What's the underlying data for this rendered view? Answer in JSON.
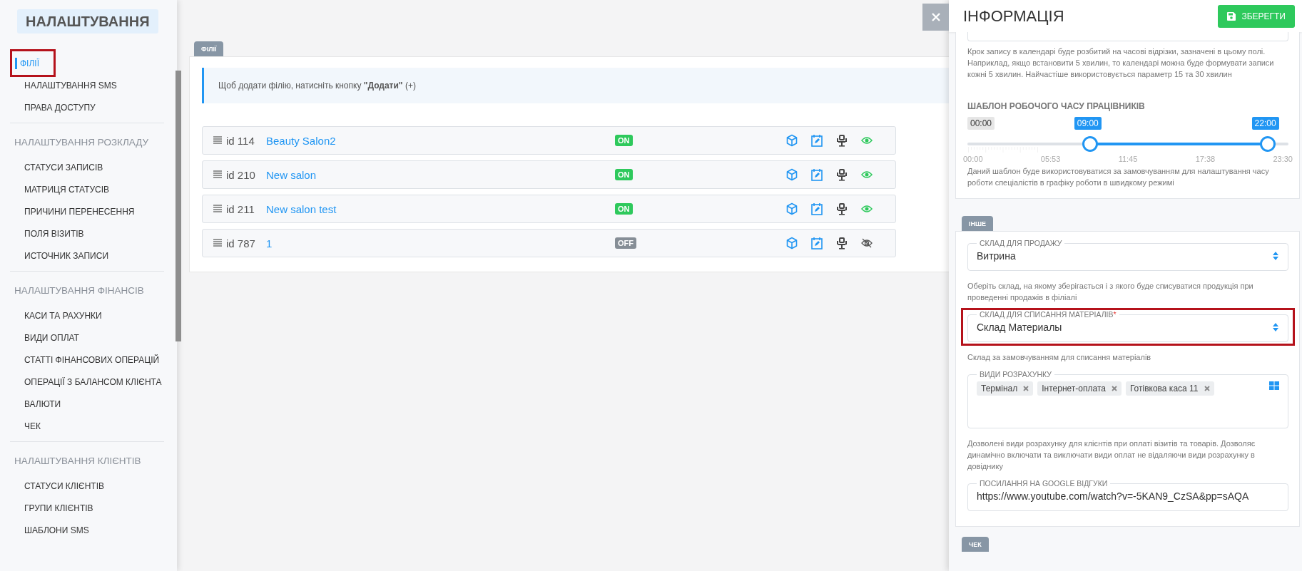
{
  "sidebar": {
    "title": "НАЛАШТУВАННЯ",
    "sections": [
      {
        "items": [
          {
            "label": "ФІЛІЇ",
            "selected": true,
            "highlighted": true
          },
          {
            "label": "НАЛАШТУВАННЯ SMS",
            "selected": false,
            "highlighted": false
          },
          {
            "label": "ПРАВА ДОСТУПУ",
            "selected": false,
            "highlighted": false
          }
        ]
      },
      {
        "heading": "НАЛАШТУВАННЯ РОЗКЛАДУ",
        "items": [
          {
            "label": "СТАТУСИ ЗАПИСІВ",
            "selected": false,
            "highlighted": false
          },
          {
            "label": "МАТРИЦЯ СТАТУСІВ",
            "selected": false,
            "highlighted": false
          },
          {
            "label": "ПРИЧИНИ ПЕРЕНЕСЕННЯ",
            "selected": false,
            "highlighted": false
          },
          {
            "label": "ПОЛЯ ВІЗИТІВ",
            "selected": false,
            "highlighted": false
          },
          {
            "label": "ИСТОЧНИК ЗАПИСИ",
            "selected": false,
            "highlighted": false
          }
        ]
      },
      {
        "heading": "НАЛАШТУВАННЯ ФІНАНСІВ",
        "items": [
          {
            "label": "КАСИ ТА РАХУНКИ",
            "selected": false,
            "highlighted": false
          },
          {
            "label": "ВИДИ ОПЛАТ",
            "selected": false,
            "highlighted": false
          },
          {
            "label": "СТАТТІ ФІНАНСОВИХ ОПЕРАЦІЙ",
            "selected": false,
            "highlighted": false
          },
          {
            "label": "ОПЕРАЦІЇ З БАЛАНСОМ КЛІЄНТА",
            "selected": false,
            "highlighted": false
          },
          {
            "label": "ВАЛЮТИ",
            "selected": false,
            "highlighted": false
          },
          {
            "label": "ЧЕК",
            "selected": false,
            "highlighted": false
          }
        ]
      },
      {
        "heading": "НАЛАШТУВАННЯ КЛІЄНТІВ",
        "items": [
          {
            "label": "СТАТУСИ КЛІЄНТІВ",
            "selected": false,
            "highlighted": false
          },
          {
            "label": "ГРУПИ КЛІЄНТІВ",
            "selected": false,
            "highlighted": false
          },
          {
            "label": "ШАБЛОНИ SMS",
            "selected": false,
            "highlighted": false
          }
        ]
      }
    ]
  },
  "branches": {
    "tab": "ФІЛІЇ",
    "notice": "Щоб додати філію, натисніть кнопку **\"Додати\"** (+)",
    "rows": [
      {
        "id": "id 114",
        "name": "Beauty Salon2",
        "status": "ON",
        "on": true,
        "visible": true
      },
      {
        "id": "id 210",
        "name": "New salon",
        "status": "ON",
        "on": true,
        "visible": true
      },
      {
        "id": "id 211",
        "name": "New salon test",
        "status": "ON",
        "on": true,
        "visible": true
      },
      {
        "id": "id 787",
        "name": "1",
        "status": "OFF",
        "on": false,
        "visible": false
      }
    ]
  },
  "panel": {
    "title": "ІНФОРМАЦІЯ",
    "save_button": "ЗБЕРЕГТИ",
    "step_hint": "Крок запису в календарі буде розбитий на часові відрізки, зазначені в цьому полі. Наприклад, якщо встановити 5 хвилин, то календарі можна буде формувати записи кожні 5 хвилин. Найчастіше використовується параметр 15 та 30 хвилин",
    "schedule": {
      "heading": "ШАБЛОН РОБОЧОГО ЧАСУ ПРАЦІВНИКІВ",
      "min_label": "00:00",
      "thumbs": [
        {
          "label": "09:00",
          "level": 0.383
        },
        {
          "label": "22:00",
          "level": 0.936
        }
      ],
      "scale": [
        "00:00",
        "05:53",
        "11:45",
        "17:38",
        "23:30"
      ],
      "hint": "Даний шаблон буде використовуватися за замовчуванням для налаштування часу роботи спеціалістів в графіку роботи в швидкому режимі"
    },
    "other_tab": "ІНШЕ",
    "fields": [
      {
        "kind": "select",
        "label": "СКЛАД ДЛЯ ПРОДАЖУ",
        "value": "Витрина",
        "highlighted": false,
        "hint": "Оберіть склад, на якому зберігається і з якого буде списуватися продукція при проведенні продажів в філіалі"
      },
      {
        "kind": "select",
        "label": "СКЛАД ДЛЯ СПИСАННЯ МАТЕРІАЛІВ",
        "required_mark": "*",
        "value": "Склад Материалы",
        "highlighted": true,
        "hint": "Склад за замовчуванням для списання матеріалів"
      },
      {
        "kind": "tags",
        "label": "ВИДИ РОЗРАХУНКУ",
        "tags": [
          "Термінал",
          "Інтернет-оплата",
          "Готівкова каса 11"
        ],
        "highlighted": false,
        "hint": "Дозволені види розрахунку для клієнтів при оплаті візитів та товарів. Дозволяє динамічно включати та виключати види оплат не відаляючи види розрахунку в довіднику"
      },
      {
        "kind": "text",
        "label": "ПОСИЛАННЯ НА GOOGLE ВІДГУКИ",
        "value": "https://www.youtube.com/watch?v=-5KAN9_CzSA&pp=sAQA",
        "highlighted": false
      }
    ],
    "receipt_tab": "ЧЕК"
  }
}
